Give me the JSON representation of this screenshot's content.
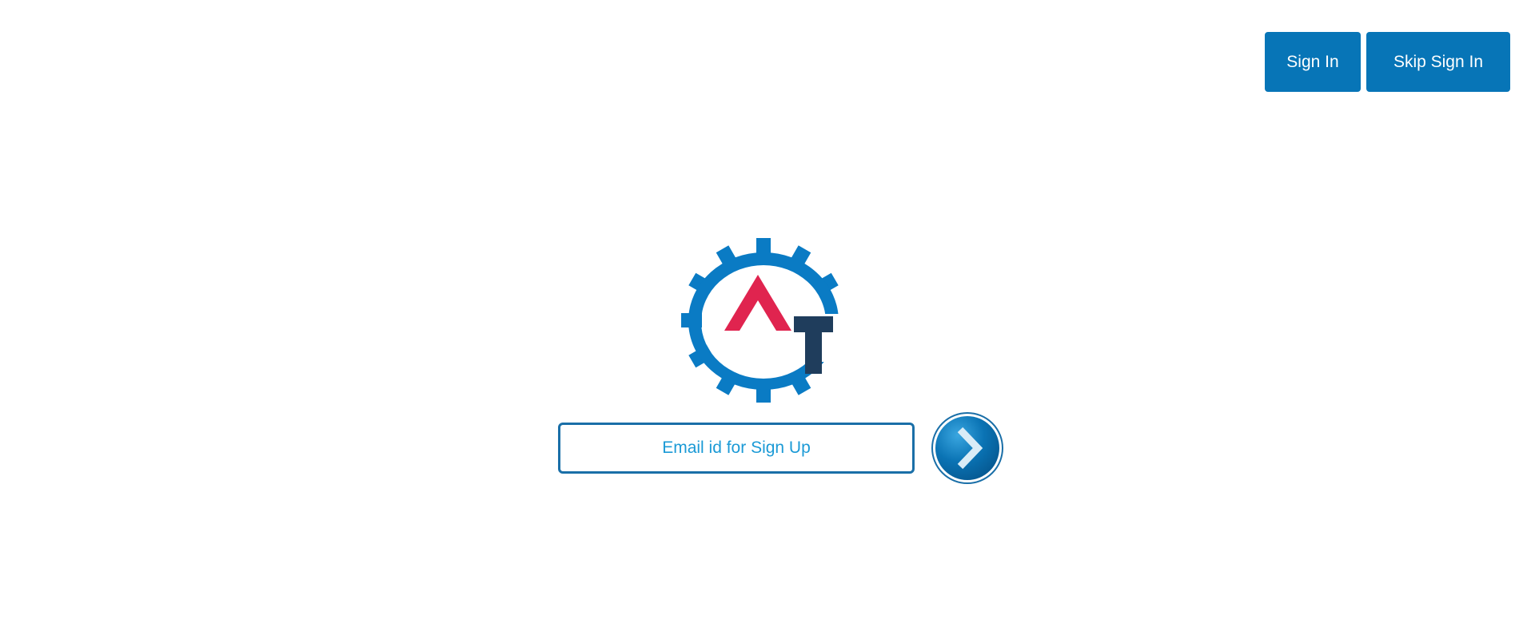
{
  "header": {
    "sign_in_label": "Sign In",
    "skip_sign_in_label": "Skip Sign In"
  },
  "signup": {
    "email_placeholder": "Email id for Sign Up",
    "email_value": ""
  },
  "logo": {
    "icon": "gear-logo-icon",
    "letters": "AT",
    "colors": {
      "gear": "#0a7bc4",
      "letter_a": "#e0244f",
      "letter_t": "#1f3d5c"
    }
  },
  "go_button": {
    "icon": "chevron-right-icon",
    "color": "#0775b7"
  },
  "colors": {
    "accent": "#0775b7",
    "input_border": "#1a6fa8",
    "input_text": "#1b9ad6"
  }
}
